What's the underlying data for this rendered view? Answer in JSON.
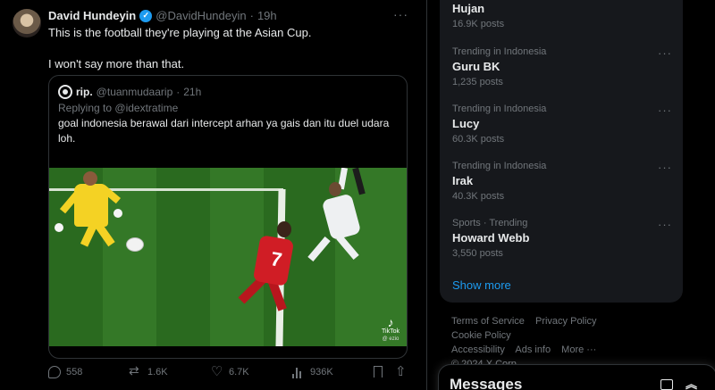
{
  "tweet": {
    "author_name": "David Hundeyin",
    "author_handle": "@DavidHundeyin",
    "time": "19h",
    "separator": "·",
    "more": "···",
    "text_line1": "This is the football they're playing at the Asian Cup.",
    "text_line2": "I won't say more than that.",
    "quote": {
      "author_name": "rip.",
      "author_handle": "@tuanmudaarip",
      "time": "21h",
      "replying_prefix": "Replying to",
      "replying_to": "@idextratime",
      "text": "goal indonesia berawal dari intercept arhan ya gais dan itu duel udara loh.",
      "video": {
        "watermark_brand": "TikTok",
        "jersey_number": "7",
        "watermark_handle": "@ ezio"
      }
    },
    "actions": {
      "replies": "558",
      "reposts": "1.6K",
      "likes": "6.7K",
      "views": "936K"
    }
  },
  "trends": {
    "items": [
      {
        "context": "",
        "name": "Hujan",
        "count": "16.9K posts"
      },
      {
        "context": "Trending in Indonesia",
        "name": "Guru BK",
        "count": "1,235 posts"
      },
      {
        "context": "Trending in Indonesia",
        "name": "Lucy",
        "count": "60.3K posts"
      },
      {
        "context": "Trending in Indonesia",
        "name": "Irak",
        "count": "40.3K posts"
      },
      {
        "context": "Sports · Trending",
        "name": "Howard Webb",
        "count": "3,550 posts"
      }
    ],
    "more_label": "···",
    "show_more": "Show more"
  },
  "footer": {
    "terms": "Terms of Service",
    "privacy": "Privacy Policy",
    "cookie": "Cookie Policy",
    "accessibility": "Accessibility",
    "ads": "Ads info",
    "more": "More ···",
    "copyright": "© 2024 X Corp."
  },
  "messages": {
    "title": "Messages"
  },
  "colors": {
    "accent": "#1d9bf0",
    "background": "#000000",
    "card": "#16181c",
    "muted": "#71767b",
    "text": "#e7e9ea"
  }
}
